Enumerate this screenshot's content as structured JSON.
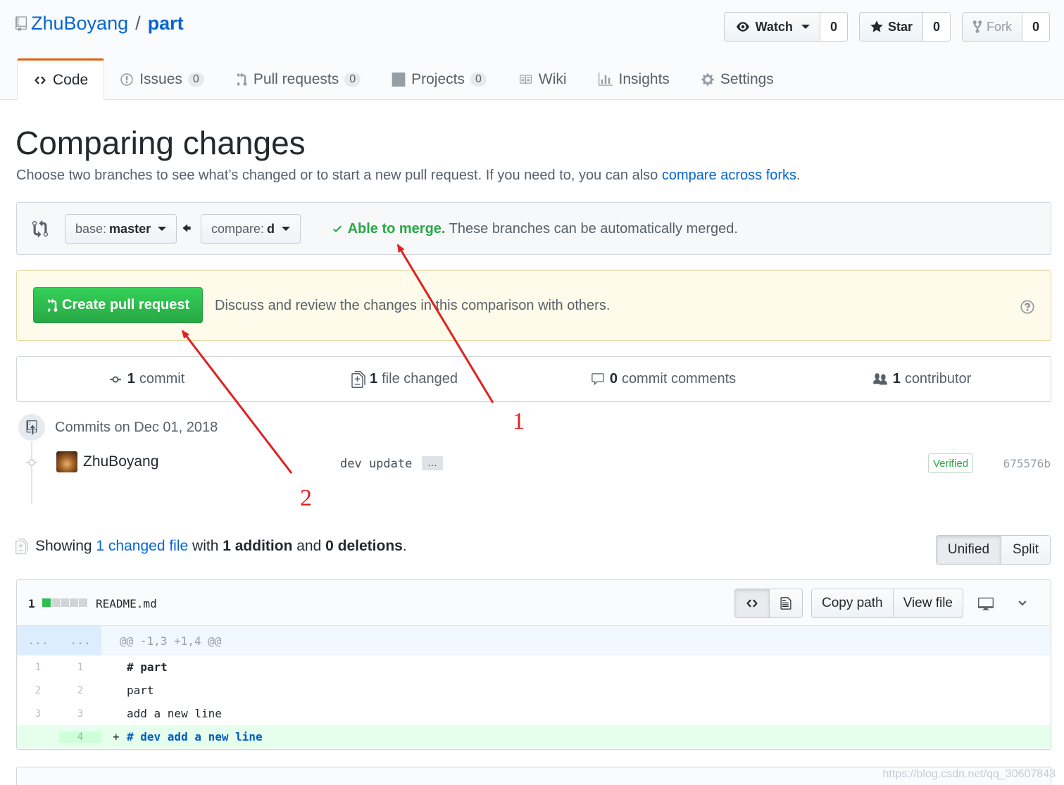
{
  "repo": {
    "owner": "ZhuBoyang",
    "sep": "/",
    "name": "part"
  },
  "actions": {
    "watch": {
      "label": "Watch",
      "count": "0"
    },
    "star": {
      "label": "Star",
      "count": "0"
    },
    "fork": {
      "label": "Fork",
      "count": "0"
    }
  },
  "tabs": [
    {
      "label": "Code"
    },
    {
      "label": "Issues",
      "count": "0"
    },
    {
      "label": "Pull requests",
      "count": "0"
    },
    {
      "label": "Projects",
      "count": "0"
    },
    {
      "label": "Wiki"
    },
    {
      "label": "Insights"
    },
    {
      "label": "Settings"
    }
  ],
  "compare": {
    "title": "Comparing changes",
    "lead_text": "Choose two branches to see what’s changed or to start a new pull request. If you need to, you can also ",
    "lead_link": "compare across forks",
    "lead_end": ".",
    "base_label": "base:",
    "base_value": "master",
    "compare_label": "compare:",
    "compare_value": "d",
    "merge_ok": "Able to merge.",
    "merge_text": " These branches can be automatically merged."
  },
  "flash": {
    "button": "Create pull request",
    "text": "Discuss and review the changes in this comparison with others."
  },
  "summary": [
    {
      "count": "1",
      "label": "commit"
    },
    {
      "count": "1",
      "label": "file changed"
    },
    {
      "count": "0",
      "label": "commit comments"
    },
    {
      "count": "1",
      "label": "contributor"
    }
  ],
  "commits": {
    "date_heading": "Commits on Dec 01, 2018",
    "author": "ZhuBoyang",
    "message": "dev update",
    "ellipsis": "…",
    "verified": "Verified",
    "sha": "675576b"
  },
  "toc": {
    "showing": "Showing",
    "link": "1 changed file",
    "with": "with",
    "additions": "1 addition",
    "and": "and",
    "deletions": "0 deletions",
    "period": "."
  },
  "view_mode": {
    "unified": "Unified",
    "split": "Split"
  },
  "file": {
    "count": "1",
    "name": "README.md",
    "copy_path": "Copy path",
    "view_file": "View file",
    "hunk_left": "...",
    "hunk_right": "...",
    "hunk_header": "@@ -1,3 +1,4 @@",
    "lines": [
      {
        "old": "1",
        "new": "1",
        "text": "# part"
      },
      {
        "old": "2",
        "new": "2",
        "text": "part"
      },
      {
        "old": "3",
        "new": "3",
        "text": "add a new line"
      },
      {
        "old": "",
        "new": "4",
        "text": "# dev add a new line"
      }
    ],
    "add_prefix": "+"
  },
  "annotations": {
    "one": "1",
    "two": "2"
  },
  "watermark": "https://blog.csdn.net/qq_30607843",
  "colors": {
    "accent": "#0366d6",
    "success": "#28a745",
    "tab_active": "#e36209",
    "arrow": "#e02020"
  }
}
